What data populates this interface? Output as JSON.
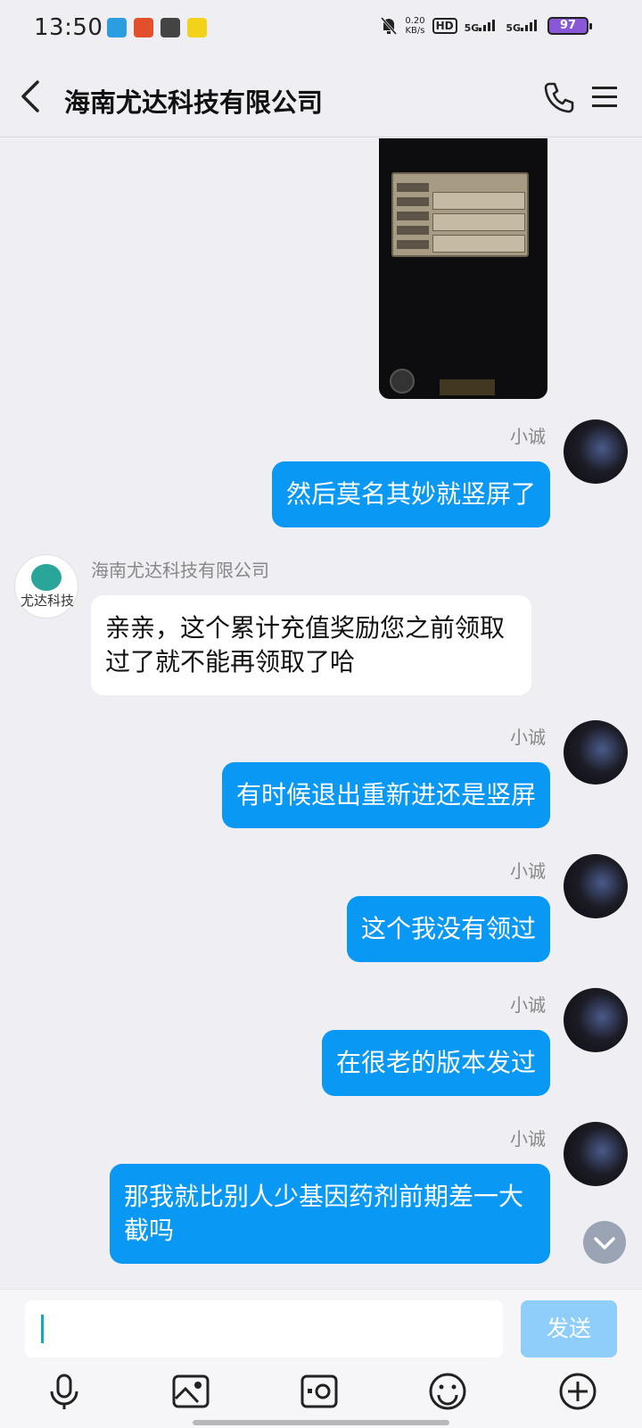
{
  "status_bar": {
    "time": "13:50",
    "net_speed_value": "0.20",
    "net_speed_unit": "KB/s",
    "hd_label": "HD",
    "sim1_label": "5G",
    "sim2_label": "5G",
    "battery": "97"
  },
  "header": {
    "title": "海南尤达科技有限公司"
  },
  "messages": [
    {
      "from": "me",
      "sender": "小诚",
      "text": "然后莫名其妙就竖屏了"
    },
    {
      "from": "company",
      "sender": "海南尤达科技有限公司",
      "text": "亲亲，这个累计充值奖励您之前领取过了就不能再领取了哈"
    },
    {
      "from": "me",
      "sender": "小诚",
      "text": "有时候退出重新进还是竖屏"
    },
    {
      "from": "me",
      "sender": "小诚",
      "text": "这个我没有领过"
    },
    {
      "from": "me",
      "sender": "小诚",
      "text": "在很老的版本发过"
    },
    {
      "from": "me",
      "sender": "小诚",
      "text": "那我就比别人少基因药剂前期差一大截吗"
    }
  ],
  "company_logo_text": "尤达科技",
  "composer": {
    "placeholder": "",
    "send_label": "发送"
  },
  "colors": {
    "my_bubble": "#0a98f5",
    "their_bubble": "#ffffff",
    "background": "#eeeef3",
    "send_button_disabled": "#8fcdfa"
  },
  "toolbar_icons": [
    "microphone-icon",
    "image-icon",
    "camera-icon",
    "emoji-icon",
    "plus-icon"
  ]
}
